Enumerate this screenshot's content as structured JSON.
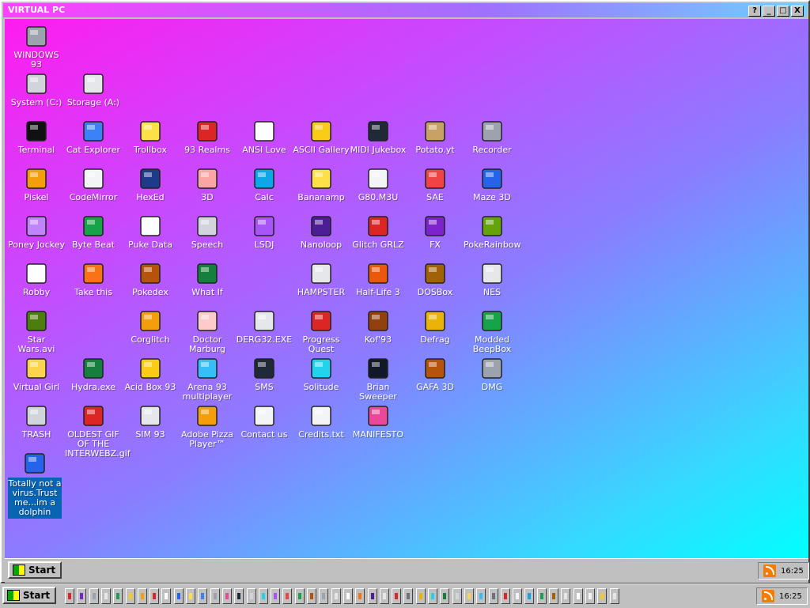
{
  "window": {
    "title": "VIRTUAL PC",
    "buttons": {
      "help": "?",
      "minimize": "_",
      "maximize": "□",
      "close": "X"
    }
  },
  "desktop": {
    "icons": [
      {
        "label": "WINDOWS 93",
        "icon": "computer-icon",
        "color": "#9ca3af"
      },
      {
        "label": "System (C:)",
        "icon": "drive-icon",
        "color": "#d1d5db"
      },
      {
        "label": "Storage (A:)",
        "icon": "floppy-drive-icon",
        "color": "#e5e7eb"
      },
      {
        "label": "Terminal",
        "icon": "terminal-icon",
        "color": "#111111"
      },
      {
        "label": "Cat Explorer",
        "icon": "globe-cat-icon",
        "color": "#3b82f6"
      },
      {
        "label": "Trollbox",
        "icon": "chat-icon",
        "color": "#fde047"
      },
      {
        "label": "93 Realms",
        "icon": "knight-icon",
        "color": "#dc2626"
      },
      {
        "label": "ANSI Love",
        "icon": "letter-a-icon",
        "color": "#ffffff"
      },
      {
        "label": "ASCII Gallery",
        "icon": "numbers-icon",
        "color": "#facc15"
      },
      {
        "label": "MIDI Jukebox",
        "icon": "piano-icon",
        "color": "#1f2937"
      },
      {
        "label": "Potato.yt",
        "icon": "potato-icon",
        "color": "#c8a165"
      },
      {
        "label": "Recorder",
        "icon": "microphone-icon",
        "color": "#9ca3af"
      },
      {
        "label": "Piskel",
        "icon": "palette-icon",
        "color": "#f59e0b"
      },
      {
        "label": "CodeMirror",
        "icon": "goat-icon",
        "color": "#f3f4f6"
      },
      {
        "label": "HexEd",
        "icon": "hex-cube-icon",
        "color": "#1e3a8a"
      },
      {
        "label": "3D",
        "icon": "teapot-icon",
        "color": "#fca5a5"
      },
      {
        "label": "Calc",
        "icon": "calculator-icon",
        "color": "#0ea5e9"
      },
      {
        "label": "Bananamp",
        "icon": "banana-icon",
        "color": "#fde047"
      },
      {
        "label": "G80.M3U",
        "icon": "speaker-icon",
        "color": "#f3f4f6"
      },
      {
        "label": "SAE",
        "icon": "amiga-ball-icon",
        "color": "#ef4444"
      },
      {
        "label": "Maze 3D",
        "icon": "maze-icon",
        "color": "#2563eb"
      },
      {
        "label": "Poney Jockey",
        "icon": "pony-icon",
        "color": "#c084fc"
      },
      {
        "label": "Byte Beat",
        "icon": "bytebeat-icon",
        "color": "#16a34a"
      },
      {
        "label": "Puke Data",
        "icon": "pd-icon",
        "color": "#ffffff"
      },
      {
        "label": "Speech",
        "icon": "face-icon",
        "color": "#d1d5db"
      },
      {
        "label": "LSDJ",
        "icon": "gameboy-icon",
        "color": "#a855f7"
      },
      {
        "label": "Nanoloop",
        "icon": "wave-icon",
        "color": "#4c1d95"
      },
      {
        "label": "Glitch GRLZ",
        "icon": "lips-icon",
        "color": "#dc2626"
      },
      {
        "label": "FX",
        "icon": "atom-icon",
        "color": "#7e22ce"
      },
      {
        "label": "PokeRainbow",
        "icon": "sprites-icon",
        "color": "#65a30d"
      },
      {
        "label": "Robby",
        "icon": "stick-figure-icon",
        "color": "#ffffff"
      },
      {
        "label": "Take this",
        "icon": "clown-icon",
        "color": "#f97316"
      },
      {
        "label": "Pokedex",
        "icon": "pokeball-icon",
        "color": "#b45309"
      },
      {
        "label": "What If",
        "icon": "matrix-icon",
        "color": "#15803d"
      },
      {
        "label": "HAMPSTER",
        "icon": "hamster-icon",
        "color": "#e5e7eb"
      },
      {
        "label": "Half-Life 3",
        "icon": "lambda-icon",
        "color": "#ea580c"
      },
      {
        "label": "DOSBox",
        "icon": "dosbox-icon",
        "color": "#a16207"
      },
      {
        "label": "NES",
        "icon": "nes-icon",
        "color": "#e5e7eb"
      },
      {
        "label": "Star Wars.avi",
        "icon": "yoda-icon",
        "color": "#4d7c0f"
      },
      {
        "label": "Corglitch",
        "icon": "corgi-icon",
        "color": "#f59e0b"
      },
      {
        "label": "Doctor Marburg",
        "icon": "doctor-icon",
        "color": "#fecaca"
      },
      {
        "label": "DERG32.EXE",
        "icon": "monitor-face-icon",
        "color": "#e5e7eb"
      },
      {
        "label": "Progress Quest",
        "icon": "swords-icon",
        "color": "#dc2626"
      },
      {
        "label": "Kof'93",
        "icon": "fighter-icon",
        "color": "#92400e"
      },
      {
        "label": "Defrag",
        "icon": "defrag-icon",
        "color": "#eab308"
      },
      {
        "label": "Modded BeepBox",
        "icon": "ring-icon",
        "color": "#16a34a"
      },
      {
        "label": "Virtual Girl",
        "icon": "portrait-icon",
        "color": "#fcd34d"
      },
      {
        "label": "Hydra.exe",
        "icon": "dragon-icon",
        "color": "#15803d"
      },
      {
        "label": "Acid Box 93",
        "icon": "smiley-icon",
        "color": "#facc15"
      },
      {
        "label": "Arena 93 multiplayer",
        "icon": "cube-icon",
        "color": "#38bdf8"
      },
      {
        "label": "SMS",
        "icon": "console-icon",
        "color": "#1f2937"
      },
      {
        "label": "Solitude",
        "icon": "jar-icon",
        "color": "#22d3ee"
      },
      {
        "label": "Brian Sweeper",
        "icon": "mine-icon",
        "color": "#111827"
      },
      {
        "label": "GAFA 3D",
        "icon": "soldier-icon",
        "color": "#b45309"
      },
      {
        "label": "DMG",
        "icon": "cartridge-icon",
        "color": "#9ca3af"
      },
      {
        "label": "TRASH",
        "icon": "trash-icon",
        "color": "#d1d5db"
      },
      {
        "label": "OLDEST GIF OF THE INTERWEBZ.gif",
        "icon": "gif-icon",
        "color": "#dc2626"
      },
      {
        "label": "SIM 93",
        "icon": "book-icon",
        "color": "#e5e7eb"
      },
      {
        "label": "Adobe Pizza Player™",
        "icon": "pizza-icon",
        "color": "#f59e0b"
      },
      {
        "label": "Contact us",
        "icon": "write-letter-icon",
        "color": "#f3f4f6"
      },
      {
        "label": "Credits.txt",
        "icon": "text-file-icon",
        "color": "#f3f4f6"
      },
      {
        "label": "MANIFESTO",
        "icon": "virtual-pc-icon",
        "color": "#ec4899"
      },
      {
        "label": "Totally not a virus.Trust me...im a dolphin",
        "icon": "dolphin-icon",
        "color": "#2563eb"
      }
    ]
  },
  "inner_taskbar": {
    "start_label": "Start",
    "clock": "16:25"
  },
  "host_taskbar": {
    "start_label": "Start",
    "clock": "16:25",
    "task_colors": [
      "#dc2626",
      "#7e22ce",
      "#9ca3af",
      "#e5e7eb",
      "#16a34a",
      "#facc15",
      "#f59e0b",
      "#dc2626",
      "#ffffff",
      "#2563eb",
      "#fde047",
      "#3b82f6",
      "#9ca3af",
      "#ec4899",
      "#1f2937",
      "#d1d5db",
      "#22d3ee",
      "#a855f7",
      "#ef4444",
      "#16a34a",
      "#b45309",
      "#9ca3af",
      "#e5e7eb",
      "#ffffff",
      "#f97316",
      "#4c1d95",
      "#e5e7eb",
      "#dc2626",
      "#6b7280",
      "#eab308",
      "#22d3ee",
      "#15803d",
      "#d1d5db",
      "#fcd34d",
      "#38bdf8",
      "#6b7280",
      "#dc2626",
      "#f3f4f6",
      "#0ea5e9",
      "#16a34a",
      "#a16207",
      "#e5e7eb",
      "#ffffff",
      "#f3f4f6",
      "#facc15",
      "#e5e7eb"
    ]
  }
}
